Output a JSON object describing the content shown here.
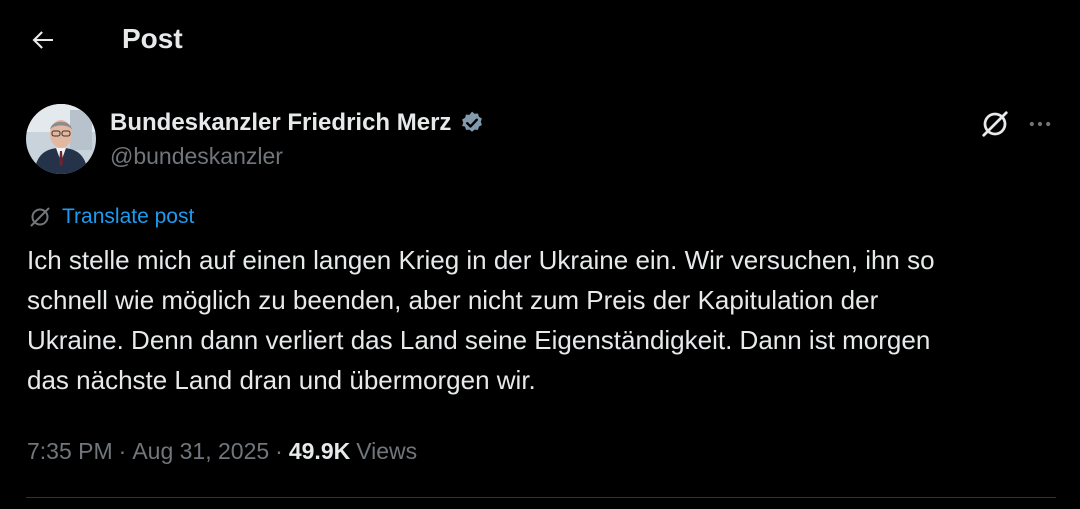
{
  "header": {
    "title": "Post",
    "back_icon": "arrow-left-icon"
  },
  "post": {
    "author": {
      "display_name": "Bundeskanzler Friedrich Merz",
      "handle": "@bundeskanzler",
      "verified": true,
      "verified_badge_color": "#829aab"
    },
    "actions": {
      "grok_icon": "grok-icon",
      "more_icon": "more-horizontal-icon"
    },
    "translate_label": "Translate post",
    "text": "Ich stelle mich auf einen langen Krieg in der Ukraine ein. Wir versuchen, ihn so\nschnell wie möglich zu beenden, aber nicht zum Preis der Kapitulation der\nUkraine. Denn dann verliert das Land seine Eigenständigkeit. Dann ist morgen\ndas nächste Land dran und übermorgen wir.",
    "meta": {
      "time": "7:35 PM",
      "separator": "·",
      "date": "Aug 31, 2025",
      "views_count": "49.9K",
      "views_label": "Views"
    }
  },
  "colors": {
    "background": "#000000",
    "text": "#e7e9ea",
    "muted": "#71767b",
    "link": "#1d9bf0",
    "divider": "#2f3336"
  }
}
